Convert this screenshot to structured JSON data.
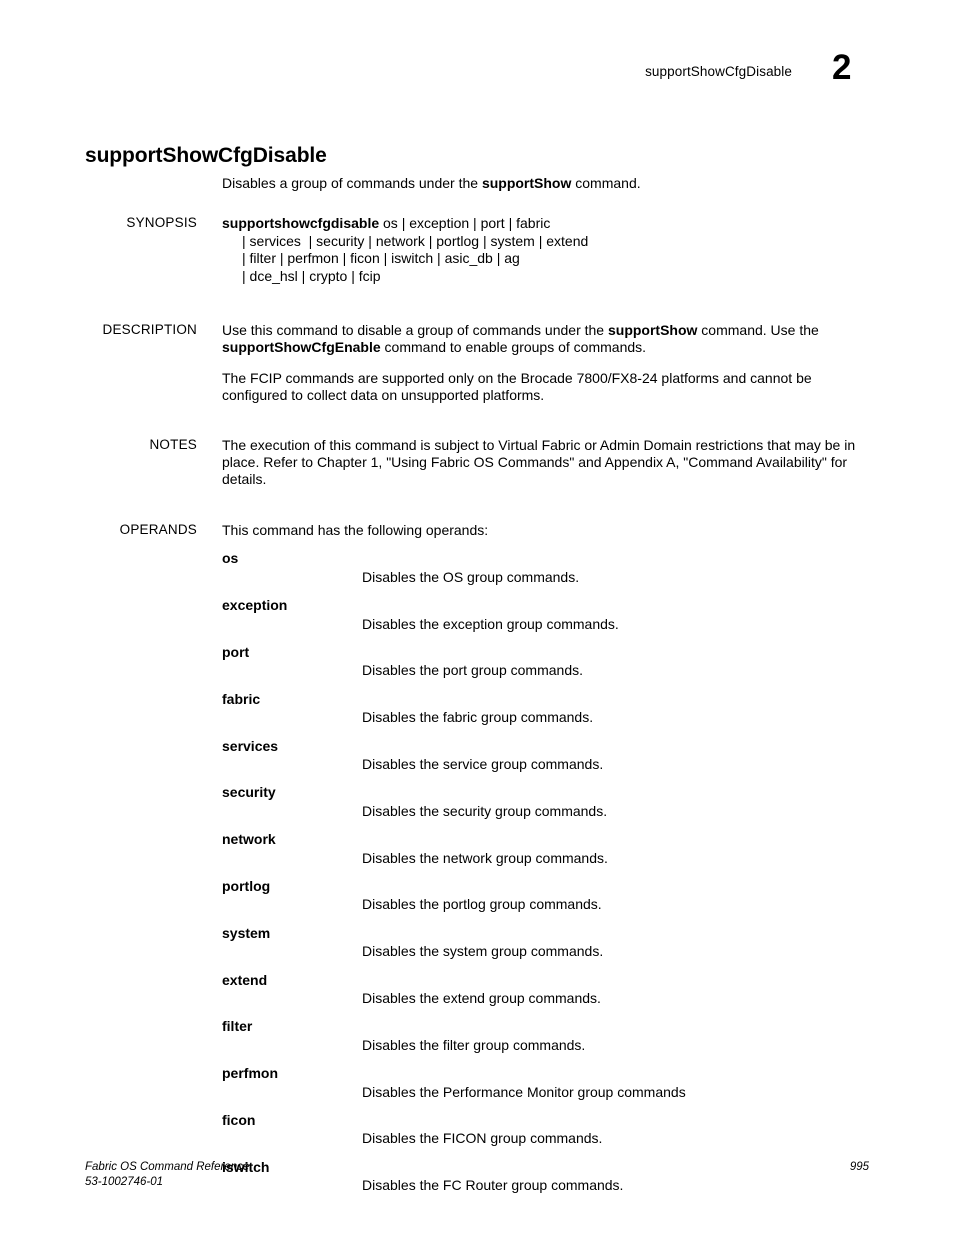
{
  "running_head": {
    "title": "supportShowCfgDisable",
    "chapter": "2"
  },
  "command_title": "supportShowCfgDisable",
  "intro": {
    "before": "Disables a group of commands under the ",
    "bold": "supportShow",
    "after": " command."
  },
  "sections": {
    "synopsis": {
      "label": "SYNOPSIS",
      "command": "supportshowcfgdisable",
      "lines": [
        " os | exception | port | fabric",
        "| services  | security | network | portlog | system | extend",
        "| filter | perfmon | ficon | iswitch | asic_db | ag",
        "| dce_hsl | crypto | fcip"
      ]
    },
    "description": {
      "label": "DESCRIPTION",
      "p1_a": "Use this command to disable a group of commands under the ",
      "p1_b1": "supportShow",
      "p1_b": " command. Use the ",
      "p1_b2": "supportShowCfgEnable",
      "p1_c": " command to enable groups of commands.",
      "p2": "The FCIP commands are supported only on the Brocade 7800/FX8-24 platforms and cannot be configured to collect data on unsupported platforms."
    },
    "notes": {
      "label": "NOTES",
      "text": "The execution of this command is subject to Virtual Fabric or Admin Domain restrictions that may be in place. Refer to Chapter 1, \"Using Fabric OS Commands\" and Appendix A, \"Command Availability\" for details."
    },
    "operands": {
      "label": "OPERANDS",
      "intro": "This command has the following operands:",
      "items": [
        {
          "term": "os",
          "desc": "Disables the OS group commands."
        },
        {
          "term": "exception",
          "desc": "Disables the exception group commands."
        },
        {
          "term": "port",
          "desc": "Disables the port group commands."
        },
        {
          "term": "fabric",
          "desc": "Disables the fabric group commands."
        },
        {
          "term": "services",
          "desc": "Disables the service group commands."
        },
        {
          "term": "security",
          "desc": "Disables the security group commands."
        },
        {
          "term": "network",
          "desc": "Disables the network group commands."
        },
        {
          "term": "portlog",
          "desc": "Disables the portlog group commands."
        },
        {
          "term": "system",
          "desc": "Disables the system group commands."
        },
        {
          "term": "extend",
          "desc": "Disables the extend group commands."
        },
        {
          "term": "filter",
          "desc": "Disables the filter group commands."
        },
        {
          "term": "perfmon",
          "desc": "Disables the Performance Monitor group commands"
        },
        {
          "term": "ficon",
          "desc": "Disables the FICON group commands."
        },
        {
          "term": "iswitch",
          "desc": "Disables the FC Router group commands."
        }
      ]
    }
  },
  "footer": {
    "doc_title": "Fabric OS Command Reference",
    "doc_number": "53-1002746-01",
    "page_number": "995"
  }
}
